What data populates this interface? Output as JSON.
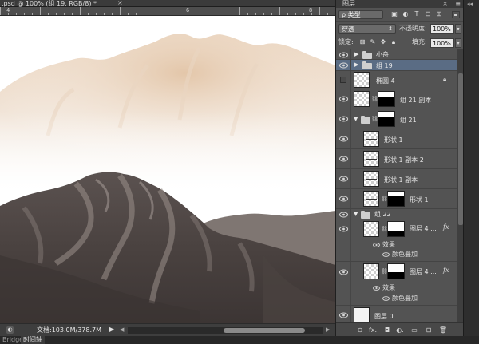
{
  "document": {
    "tab_title": ".psd @ 100% (组 19, RGB/8) *",
    "tab_close": "×"
  },
  "ruler": {
    "labels": [
      "4",
      "6",
      "8"
    ]
  },
  "status_bar": {
    "zoom_icon": "◐",
    "doc_info": "文档:103.0M/378.7M",
    "arrow": "▶",
    "left_arrow": "◀",
    "right_arrow": "▶"
  },
  "bottom_tabs": [
    "Bridge",
    "时间轴"
  ],
  "layers_panel": {
    "title": "图层",
    "menu_icon": "≡",
    "close_icon": "×",
    "filter": {
      "kind_label": "ρ 类型",
      "icons": [
        "image-filter-icon",
        "adjustment-filter-icon",
        "type-filter-icon",
        "shape-filter-icon",
        "smart-object-filter-icon"
      ],
      "icon_glyphs": [
        "▣",
        "◐",
        "T",
        "⊡",
        "⊞"
      ]
    },
    "blend": {
      "mode": "穿透",
      "opacity_label": "不透明度:",
      "opacity_value": "100%"
    },
    "lock": {
      "label": "锁定:",
      "icons": [
        "lock-transparent-icon",
        "lock-paint-icon",
        "lock-position-icon",
        "lock-all-icon"
      ],
      "icon_glyphs": [
        "⊠",
        "✎",
        "✥",
        "🔒︎"
      ],
      "fill_label": "填充:",
      "fill_value": "100%"
    },
    "layers": [
      {
        "name": "小舟",
        "kind": "group",
        "visible": true,
        "expanded": false,
        "indent": 0
      },
      {
        "name": "组 19",
        "kind": "group",
        "visible": true,
        "expanded": false,
        "indent": 0,
        "selected": true
      },
      {
        "name": "椭圆 4",
        "kind": "shape",
        "visible": false,
        "locked": true,
        "indent": 0
      },
      {
        "name": "组 21 副本",
        "kind": "masked",
        "visible": true,
        "indent": 0
      },
      {
        "name": "组 21",
        "kind": "group-masked",
        "visible": true,
        "expanded": true,
        "indent": 0
      },
      {
        "name": "形状 1",
        "kind": "shape",
        "visible": true,
        "indent": 1
      },
      {
        "name": "形状 1 副本 2",
        "kind": "shape",
        "visible": true,
        "indent": 1
      },
      {
        "name": "形状 1 副本",
        "kind": "shape",
        "visible": true,
        "indent": 1
      },
      {
        "name": "形状 1",
        "kind": "shape-masked",
        "visible": true,
        "indent": 1
      },
      {
        "name": "组 22",
        "kind": "group",
        "visible": true,
        "expanded": true,
        "indent": 0
      },
      {
        "name": "图层 4 ...",
        "kind": "layer-fx",
        "visible": true,
        "indent": 1,
        "fx": "fx",
        "effects_label": "效果",
        "effect": "颜色叠加"
      },
      {
        "name": "图层 4 ...",
        "kind": "layer-fx",
        "visible": true,
        "indent": 1,
        "fx": "fx",
        "effects_label": "效果",
        "effect": "颜色叠加"
      },
      {
        "name": "图层 0",
        "kind": "layer",
        "visible": true,
        "indent": 0
      }
    ],
    "footer_icons": [
      "link-layers-icon",
      "add-style-icon",
      "add-mask-icon",
      "adjustment-layer-icon",
      "new-group-icon",
      "new-layer-icon",
      "delete-layer-icon"
    ],
    "footer_glyphs": [
      "⊖",
      "fx.",
      "◘",
      "◐.",
      "▭",
      "⊡",
      "🗑︎"
    ]
  }
}
